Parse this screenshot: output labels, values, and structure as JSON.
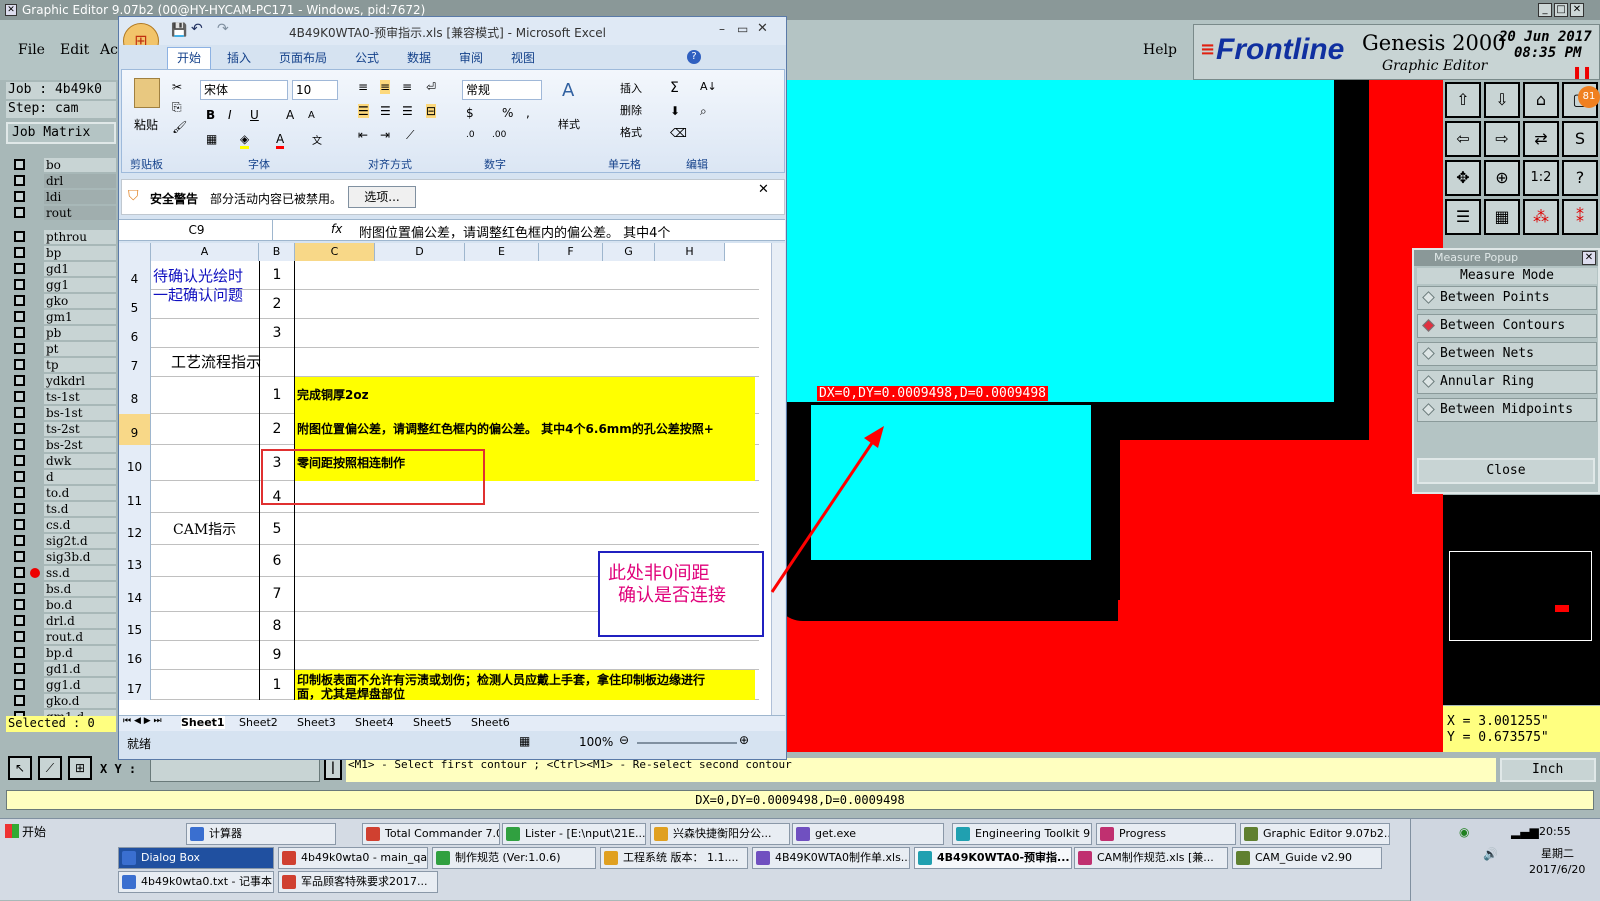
{
  "ge": {
    "title": "Graphic Editor 9.07b2 (00@HY-HYCAM-PC171 - Windows, pid:7672)",
    "menu": [
      "File",
      "Edit",
      "Ac"
    ],
    "help": "Help",
    "brand": "Frontline",
    "product": "Genesis 2000",
    "subtitle": "Graphic Editor",
    "date": "20 Jun 2017",
    "time": "08:35 PM",
    "job_label": "Job : 4b49k0",
    "step_label": "Step: cam",
    "job_matrix": "Job Matrix",
    "layers": [
      "bo",
      "drl",
      "ldi",
      "rout",
      "pthrou",
      "bp",
      "gd1",
      "gg1",
      "gko",
      "gm1",
      "pb",
      "pt",
      "tp",
      "ydkdrl",
      "ts-1st",
      "bs-1st",
      "ts-2st",
      "bs-2st",
      "dwk",
      "d",
      "to.d",
      "ts.d",
      "cs.d",
      "sig2t.d",
      "sig3b.d",
      "ss.d",
      "bs.d",
      "bo.d",
      "drl.d",
      "rout.d",
      "bp.d",
      "gd1.d",
      "gg1.d",
      "gko.d",
      "gm1.d"
    ],
    "selected": "Selected : 0",
    "xy_label": "X Y :",
    "prompt": "<M1> - Select first contour ; <Ctrl><M1> - Re-select second contour",
    "units": "Inch",
    "status": "DX=0,DY=0.0009498,D=0.0009498",
    "measure_readout": "DX=0,DY=0.0009498,D=0.0009498",
    "coord_x": "X  =  3.001255\"",
    "coord_y": "Y  =  0.673575\"",
    "tool_badge": "81",
    "ratio_btn": "1:2",
    "help_btn": "?"
  },
  "measure": {
    "title": "Measure Popup",
    "mode": "Measure Mode",
    "options": [
      "Between Points",
      "Between Contours",
      "Between Nets",
      "Annular Ring",
      "Between Midpoints"
    ],
    "selected_index": 1,
    "close": "Close"
  },
  "annotation": {
    "line1": "此处非0间距",
    "line2": "确认是否连接"
  },
  "excel": {
    "title": "4B49K0WTA0-预审指示.xls  [兼容模式] - Microsoft Excel",
    "tabs": [
      "开始",
      "插入",
      "页面布局",
      "公式",
      "数据",
      "审阅",
      "视图"
    ],
    "groups": [
      "剪贴板",
      "字体",
      "对齐方式",
      "数字",
      "单元格",
      "编辑"
    ],
    "paste": "粘贴",
    "font_name": "宋体",
    "font_size": "10",
    "number_format": "常规",
    "style_label": "样式",
    "cells_btns": [
      "插入",
      "删除",
      "格式"
    ],
    "security_label": "安全警告",
    "security_msg": "部分活动内容已被禁用。",
    "options_btn": "选项...",
    "name_box": "C9",
    "fx": "fx",
    "formula": "附图位置偏公差，请调整红色框内的偏公差。  其中4个",
    "columns": [
      "A",
      "B",
      "C",
      "D",
      "E",
      "F",
      "G",
      "H"
    ],
    "rows": [
      {
        "num": "4",
        "b": "1",
        "c": "",
        "y": false
      },
      {
        "num": "5",
        "b": "2",
        "c": "",
        "y": false
      },
      {
        "num": "6",
        "b": "3",
        "c": "",
        "y": false
      },
      {
        "num": "7",
        "b": "",
        "c": "",
        "y": false
      },
      {
        "num": "8",
        "b": "1",
        "c": "完成铜厚2oz",
        "y": true
      },
      {
        "num": "9",
        "b": "2",
        "c": "附图位置偏公差，请调整红色框内的偏公差。  其中4个6.6mm的孔公差按照+",
        "y": true
      },
      {
        "num": "10",
        "b": "3",
        "c": "零间距按照相连制作",
        "y": true
      },
      {
        "num": "11",
        "b": "4",
        "c": "",
        "y": false
      },
      {
        "num": "12",
        "b": "5",
        "c": "",
        "y": false
      },
      {
        "num": "13",
        "b": "6",
        "c": "",
        "y": false
      },
      {
        "num": "14",
        "b": "7",
        "c": "",
        "y": false
      },
      {
        "num": "15",
        "b": "8",
        "c": "",
        "y": false
      },
      {
        "num": "16",
        "b": "9",
        "c": "",
        "y": false
      },
      {
        "num": "17",
        "b": "1",
        "c": "印制板表面不允许有污渍或划伤；检测人员应戴上手套，拿住印制板边缘进行",
        "c2": "面，尤其是焊盘部位",
        "y": true
      }
    ],
    "a_text1": "待确认光绘时一起确认问题",
    "a_text2": "工艺流程指示",
    "a_text3": "CAM指示",
    "sheets": [
      "Sheet1",
      "Sheet2",
      "Sheet3",
      "Sheet4",
      "Sheet5",
      "Sheet6"
    ],
    "status_ready": "就绪",
    "zoom": "100%"
  },
  "taskbar": {
    "start": "开始",
    "row1": [
      "计算器",
      "Total Commander 7.0...",
      "Lister - [E:\\nput\\21E...",
      "兴森快捷衡阳分公...",
      "get.exe",
      "Engineering Toolkit 9....",
      "Progress",
      "Graphic Editor 9.07b2..."
    ],
    "row2": [
      "Dialog Box",
      "4b49k0wta0 - main_qa",
      "制作规范 (Ver:1.0.6)",
      "工程系统  版本： 1.1....",
      "4B49K0WTA0制作单.xls...",
      "4B49K0WTA0-预审指...",
      "CAM制作规范.xls  [兼...",
      "CAM_Guide v2.90"
    ],
    "row3": [
      "4b49k0wta0.txt - 记事本",
      "军品顾客特殊要求2017..."
    ],
    "clock_time": "20:55",
    "clock_day": "星期二",
    "clock_date": "2017/6/20"
  },
  "colors": {
    "cyan": "#00ffff",
    "red": "#ff0000",
    "yellow": "#ffff00",
    "annot": "#e0007a",
    "frame": "#2020c0"
  }
}
